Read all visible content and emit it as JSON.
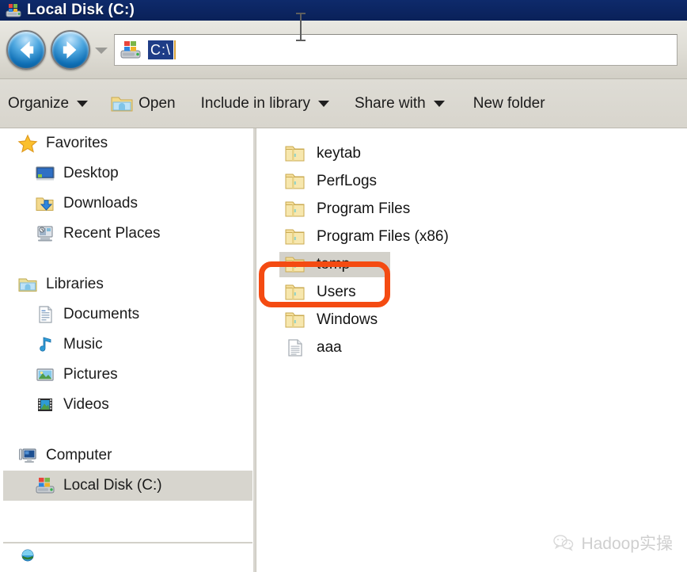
{
  "window": {
    "title": "Local Disk (C:)",
    "title_icon": "local-disk-icon"
  },
  "navbar": {
    "back_label": "Back",
    "forward_label": "Forward",
    "recent_pages_label": "Recent pages",
    "address": {
      "icon": "local-disk-icon",
      "value": "C:\\",
      "placeholder": "C:\\"
    }
  },
  "toolbar": {
    "items": [
      {
        "label": "Organize",
        "icon": "",
        "has_caret": true
      },
      {
        "label": "Open",
        "icon": "folder-open-icon",
        "has_caret": false
      },
      {
        "label": "Include in library",
        "icon": "",
        "has_caret": true
      },
      {
        "label": "Share with",
        "icon": "",
        "has_caret": true
      },
      {
        "label": "New folder",
        "icon": "",
        "has_caret": false
      }
    ]
  },
  "sidebar": {
    "groups": [
      {
        "header": {
          "label": "Favorites",
          "icon": "star-icon"
        },
        "items": [
          {
            "label": "Desktop",
            "icon": "desktop-icon"
          },
          {
            "label": "Downloads",
            "icon": "downloads-icon"
          },
          {
            "label": "Recent Places",
            "icon": "recent-places-icon"
          }
        ]
      },
      {
        "header": {
          "label": "Libraries",
          "icon": "libraries-icon"
        },
        "items": [
          {
            "label": "Documents",
            "icon": "documents-icon"
          },
          {
            "label": "Music",
            "icon": "music-icon"
          },
          {
            "label": "Pictures",
            "icon": "pictures-icon"
          },
          {
            "label": "Videos",
            "icon": "videos-icon"
          }
        ]
      },
      {
        "header": {
          "label": "Computer",
          "icon": "computer-icon"
        },
        "items": [
          {
            "label": "Local Disk (C:)",
            "icon": "local-disk-icon",
            "selected": true
          }
        ]
      },
      {
        "header": {
          "label": "",
          "icon": "network-icon"
        },
        "items": []
      }
    ]
  },
  "file_list": {
    "items": [
      {
        "name": "keytab",
        "icon": "folder-icon",
        "selected": false
      },
      {
        "name": "PerfLogs",
        "icon": "folder-icon",
        "selected": false
      },
      {
        "name": "Program Files",
        "icon": "folder-icon",
        "selected": false
      },
      {
        "name": "Program Files (x86)",
        "icon": "folder-icon",
        "selected": false
      },
      {
        "name": "temp",
        "icon": "folder-icon",
        "selected": true
      },
      {
        "name": "Users",
        "icon": "folder-icon",
        "selected": false
      },
      {
        "name": "Windows",
        "icon": "folder-icon",
        "selected": false
      },
      {
        "name": "aaa",
        "icon": "text-file-icon",
        "selected": false
      }
    ]
  },
  "annotation": {
    "target": "temp",
    "shape": "rounded-rectangle",
    "color": "#f44b12"
  },
  "cursor": {
    "type": "ibeam"
  },
  "watermark": {
    "icon": "wechat-icon",
    "text": "Hadoop实操"
  },
  "colors": {
    "titlebar": "#0c2461",
    "chrome": "#d8d5cd",
    "selection_highlight": "#d3d1ca",
    "address_selection": "#1f3d87",
    "annotation_red": "#f44b12"
  }
}
